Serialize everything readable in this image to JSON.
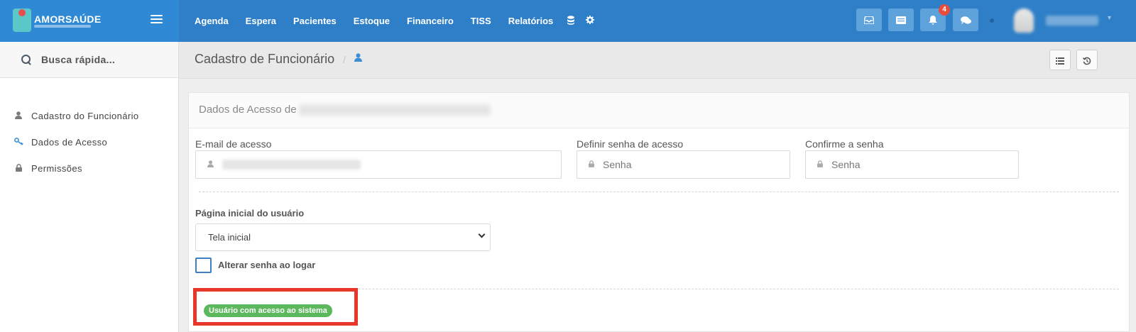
{
  "brand": {
    "logo_text": "AMORSAÚDE"
  },
  "nav": {
    "items": [
      {
        "label": "Agenda"
      },
      {
        "label": "Espera"
      },
      {
        "label": "Pacientes"
      },
      {
        "label": "Estoque"
      },
      {
        "label": "Financeiro"
      },
      {
        "label": "TISS"
      },
      {
        "label": "Relatórios"
      }
    ],
    "icons": [
      "database-icon",
      "gear-icon"
    ]
  },
  "topbar": {
    "buttons": [
      "inbox-icon",
      "card-icon",
      "bell-icon",
      "chat-icon"
    ],
    "notifications_count": "4"
  },
  "sidebar": {
    "search_placeholder": "Busca rápida...",
    "items": [
      {
        "label": "Cadastro do Funcionário",
        "icon": "user-icon"
      },
      {
        "label": "Dados de Acesso",
        "icon": "key-icon"
      },
      {
        "label": "Permissões",
        "icon": "lock-icon"
      }
    ]
  },
  "header": {
    "title": "Cadastro de Funcionário",
    "separator": "/",
    "actions": [
      "list-icon",
      "history-icon"
    ]
  },
  "panel": {
    "title_prefix": "Dados de Acesso de",
    "email_label": "E-mail de acesso",
    "password_label": "Definir senha de acesso",
    "password_placeholder": "Senha",
    "confirm_label": "Confirme a senha",
    "confirm_placeholder": "Senha",
    "homepage_label": "Página inicial do usuário",
    "homepage_value": "Tela inicial",
    "change_password_label": "Alterar senha ao logar",
    "change_password_checked": false,
    "status_badge": "Usuário com acesso ao sistema"
  },
  "colors": {
    "topbar": "#2e7fc7",
    "accent": "#3c8dd6",
    "badge_red": "#e74c3c",
    "status_green": "#5cb85c",
    "highlight_red": "#e8362a"
  }
}
